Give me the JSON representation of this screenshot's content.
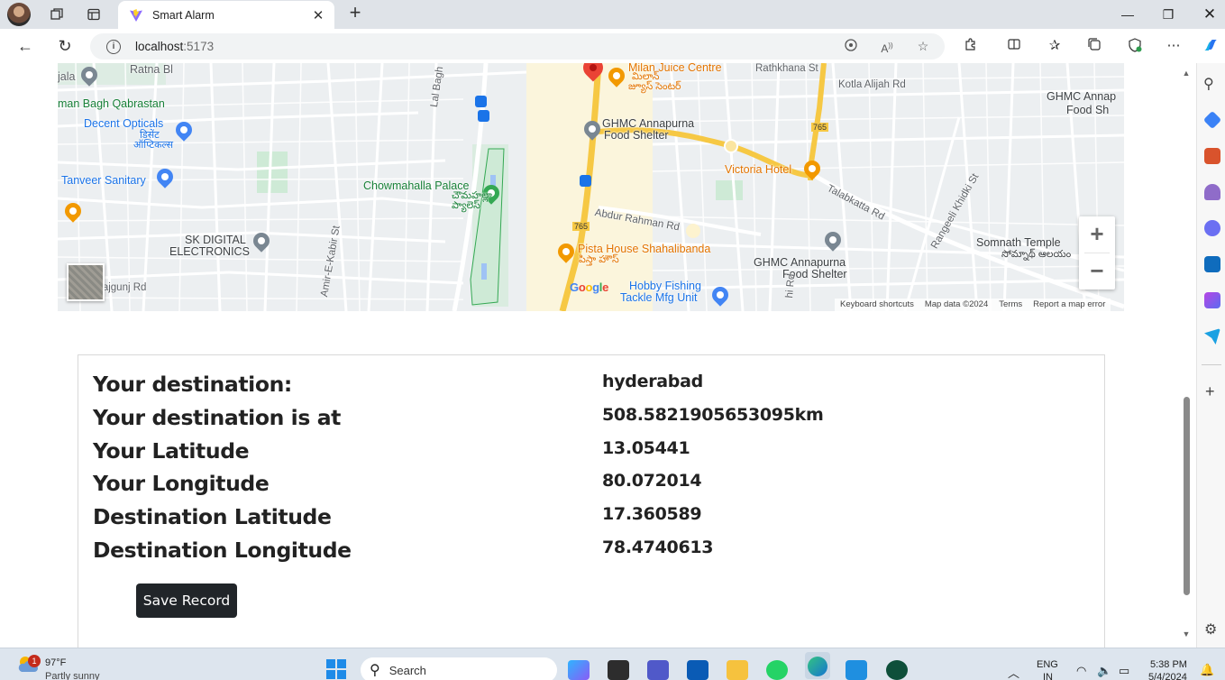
{
  "browser": {
    "tab_title": "Smart Alarm",
    "address_host": "localhost",
    "address_port": ":5173"
  },
  "map": {
    "labels": [
      {
        "text": "Ratna Bl",
        "cls": "poi-dark"
      },
      {
        "text": "jala",
        "cls": "poi-dark"
      },
      {
        "text": "man Bagh Qabrastan",
        "cls": "poi-green"
      },
      {
        "text": "Decent Opticals",
        "cls": "poi-blue"
      },
      {
        "text": "डिसेंट",
        "cls": "poi-blue"
      },
      {
        "text": "ऑप्टिकल्स",
        "cls": "poi-blue"
      },
      {
        "text": "Tanveer Sanitary",
        "cls": "poi-blue"
      },
      {
        "text": "SK DIGITAL",
        "cls": "poi-dark"
      },
      {
        "text": "ELECTRONICS",
        "cls": "poi-dark"
      },
      {
        "text": "rajgunj Rd",
        "cls": "road"
      },
      {
        "text": "Amir-E-Kabir St",
        "cls": "road"
      },
      {
        "text": "Lal Bagh",
        "cls": "road"
      },
      {
        "text": "Chowmahalla Palace",
        "cls": "poi-green"
      },
      {
        "text": "చౌమహల్లా",
        "cls": "poi-green"
      },
      {
        "text": "ప్యాలెస్",
        "cls": "poi-green"
      },
      {
        "text": "Milan Juice Centre",
        "cls": "poi-orange"
      },
      {
        "text": "మిలాన్",
        "cls": "poi-orange"
      },
      {
        "text": "జ్యూస్ సెంటర్",
        "cls": "poi-orange"
      },
      {
        "text": "Rathkhana St",
        "cls": "road"
      },
      {
        "text": "Kotla Alijah Rd",
        "cls": "road"
      },
      {
        "text": "GHMC Annapurna",
        "cls": "poi-dark"
      },
      {
        "text": "Food Shelter",
        "cls": "poi-dark"
      },
      {
        "text": "Victoria Hotel",
        "cls": "poi-orange"
      },
      {
        "text": "GHMC Annap",
        "cls": "poi-dark"
      },
      {
        "text": "Food Sh",
        "cls": "poi-dark"
      },
      {
        "text": "Abdur Rahman Rd",
        "cls": "road"
      },
      {
        "text": "Talabkatta Rd",
        "cls": "road"
      },
      {
        "text": "Rangeeli Khidki St",
        "cls": "road"
      },
      {
        "text": "Pista House Shahalibanda",
        "cls": "poi-orange"
      },
      {
        "text": "పిస్తా హౌస్",
        "cls": "poi-orange"
      },
      {
        "text": "GHMC Annapurna",
        "cls": "poi-dark"
      },
      {
        "text": "Food Shelter",
        "cls": "poi-dark"
      },
      {
        "text": "Somnath Temple",
        "cls": "poi-dark"
      },
      {
        "text": "సోమ్నాథ్ ఆలయం",
        "cls": "poi-dark"
      },
      {
        "text": "Hobby Fishing",
        "cls": "poi-blue"
      },
      {
        "text": "Tackle Mfg Unit",
        "cls": "poi-blue"
      },
      {
        "text": "765",
        "cls": "poi-dark"
      },
      {
        "text": "765",
        "cls": "poi-dark"
      },
      {
        "text": "hi Rd",
        "cls": "road"
      }
    ],
    "footer": [
      "Keyboard shortcuts",
      "Map data ©2024",
      "Terms",
      "Report a map error"
    ],
    "zoom_in": "+",
    "zoom_out": "−"
  },
  "info": {
    "rows": [
      {
        "label": "Your destination:",
        "value": "hyderabad"
      },
      {
        "label": "Your destination is at",
        "value": "508.5821905653095km"
      },
      {
        "label": "Your Latitude",
        "value": "13.05441"
      },
      {
        "label": "Your Longitude",
        "value": "80.072014"
      },
      {
        "label": "Destination Latitude",
        "value": "17.360589"
      },
      {
        "label": "Destination Longitude",
        "value": "78.4740613"
      }
    ],
    "save_button": "Save Record"
  },
  "taskbar": {
    "weather_badge": "1",
    "weather_temp": "97°F",
    "weather_desc": "Partly sunny",
    "search_placeholder": "Search",
    "lang_line1": "ENG",
    "lang_line2": "IN",
    "time": "5:38 PM",
    "date": "5/4/2024"
  }
}
